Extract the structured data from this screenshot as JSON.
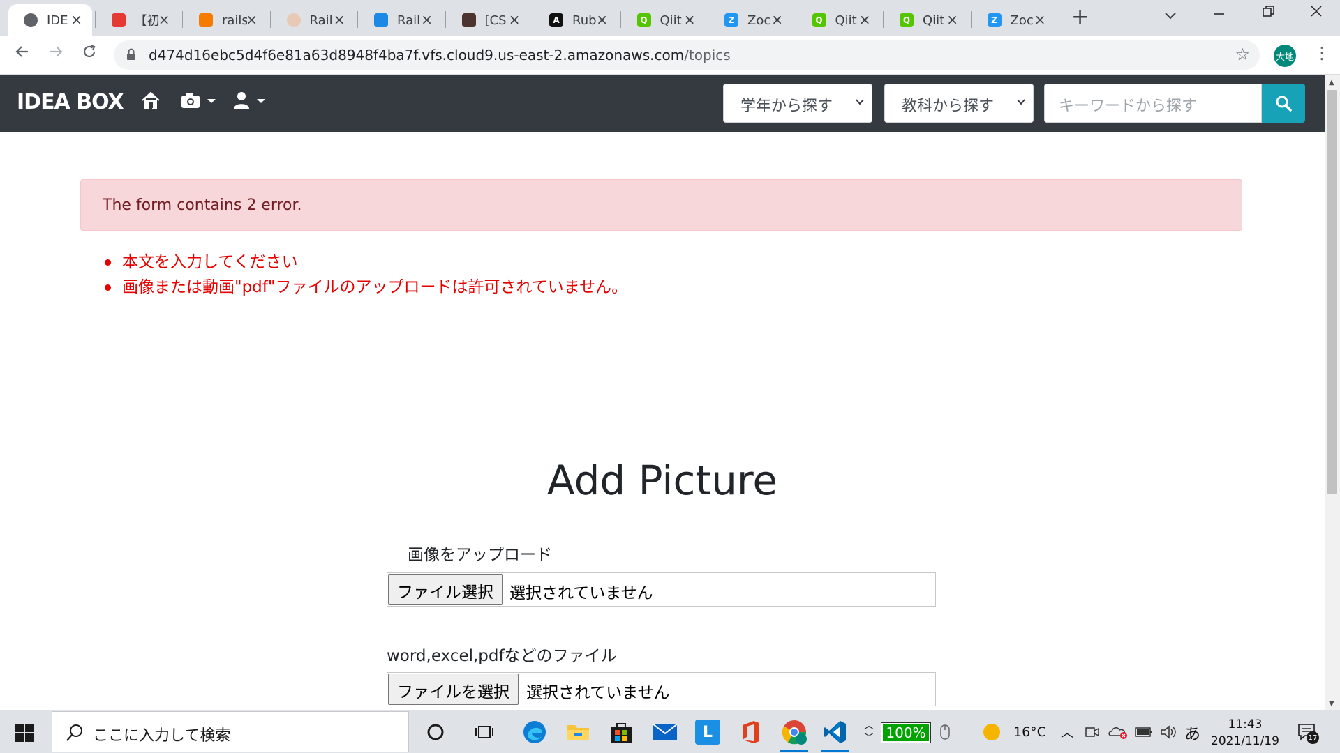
{
  "browser": {
    "tabs": [
      {
        "title": "IDE",
        "favicon_color": "#5f6368",
        "favicon": "globe"
      },
      {
        "title": "【初",
        "favicon_color": "#e53935",
        "favicon": "code"
      },
      {
        "title": "rails",
        "favicon_color": "#f57c00",
        "favicon": "box"
      },
      {
        "title": "Rail",
        "favicon_color": "#e8c9b6",
        "favicon": "circle"
      },
      {
        "title": "Rail",
        "favicon_color": "#1e88e5",
        "favicon": "slash"
      },
      {
        "title": "[CS",
        "favicon_color": "#4e342e",
        "favicon": "diamond"
      },
      {
        "title": "Rub",
        "favicon_color": "#111111",
        "favicon": "A"
      },
      {
        "title": "Qiit",
        "favicon_color": "#55c500",
        "favicon": "Q"
      },
      {
        "title": "Zoc",
        "favicon_color": "#2196f3",
        "favicon": "Z"
      },
      {
        "title": "Qiit",
        "favicon_color": "#55c500",
        "favicon": "Q"
      },
      {
        "title": "Qiit",
        "favicon_color": "#55c500",
        "favicon": "Q"
      },
      {
        "title": "Zoc",
        "favicon_color": "#2196f3",
        "favicon": "Z"
      }
    ],
    "url_host": "d474d16ebc5d4f6e81a63d8948f4ba7f.vfs.cloud9.us-east-2.amazonaws.com",
    "url_path": "/topics",
    "profile_label": "大地"
  },
  "navbar": {
    "brand": "IDEA BOX",
    "grade_select": "学年から探す",
    "subject_select": "教科から探す",
    "search_placeholder": "キーワードから探す"
  },
  "alert": {
    "message": "The form contains 2 error.",
    "errors": [
      "本文を入力してください",
      "画像または動画\"pdf\"ファイルのアップロードは許可されていません。"
    ]
  },
  "form": {
    "title": "Add Picture",
    "image_label": "画像をアップロード",
    "image_button": "ファイル選択",
    "image_status": "選択されていません",
    "file_label": "word,excel,pdfなどのファイル",
    "file_button": "ファイルを選択",
    "file_status": "選択されていません"
  },
  "taskbar": {
    "search_placeholder": "ここに入力して検索",
    "battery": "100%",
    "temperature": "16°C",
    "ime": "あ",
    "time": "11:43",
    "date": "2021/11/19",
    "notifications": "17"
  },
  "colors": {
    "navbar_bg": "#343a40",
    "search_btn": "#17a2b8",
    "alert_bg": "#f8d7da",
    "alert_text": "#721c24",
    "error_text": "#e60000"
  }
}
